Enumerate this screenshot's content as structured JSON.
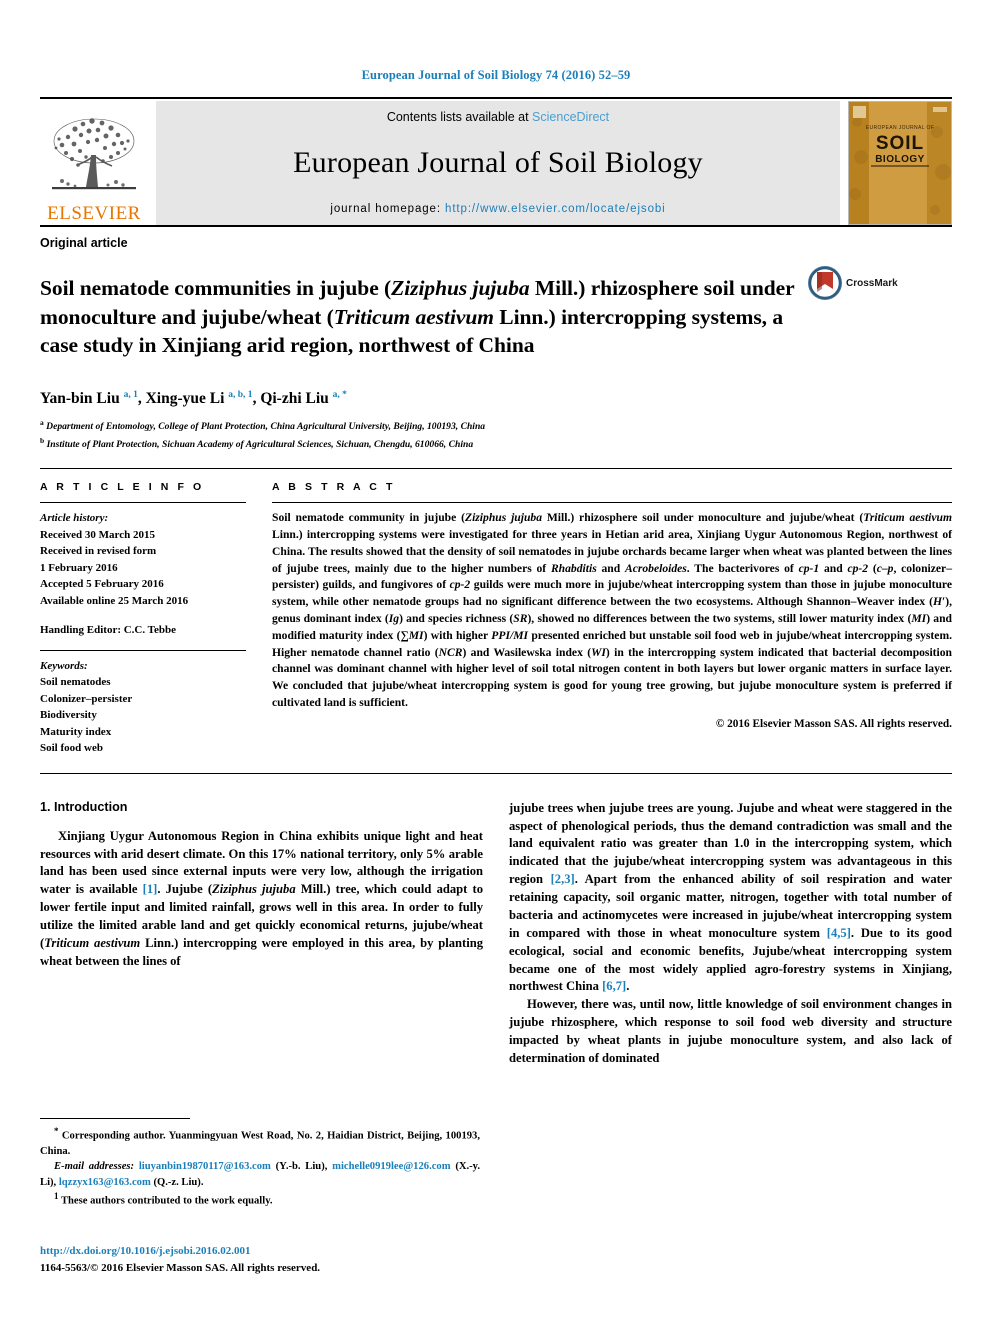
{
  "running_head": "European Journal of Soil Biology 74 (2016) 52–59",
  "header": {
    "contents_prefix": "Contents lists available at ",
    "sciencedirect": "ScienceDirect",
    "journal_title": "European Journal of Soil Biology",
    "homepage_prefix": "journal homepage: ",
    "homepage_url": "http://www.elsevier.com/locate/ejsobi",
    "publisher_logo_text": "ELSEVIER",
    "cover_lines": [
      "EUROPEAN JOURNAL OF",
      "SOIL",
      "BIOLOGY"
    ],
    "accent_link_color": "#1a7fba",
    "sciencedirect_color": "#4a9ed0",
    "elsevier_orange": "#E77500",
    "band_bg": "#e6e6e6"
  },
  "article": {
    "type": "Original article",
    "title_parts": [
      {
        "t": "Soil nematode communities in jujube (",
        "i": false
      },
      {
        "t": "Ziziphus jujuba",
        "i": true
      },
      {
        "t": " Mill.) rhizosphere soil under monoculture and jujube/wheat (",
        "i": false
      },
      {
        "t": "Triticum aestivum",
        "i": true
      },
      {
        "t": " Linn.) intercropping systems, a case study in Xinjiang arid region, northwest of China",
        "i": false
      }
    ],
    "title_plain": "Soil nematode communities in jujube (Ziziphus jujuba Mill.) rhizosphere soil under monoculture and jujube/wheat (Triticum aestivum Linn.) intercropping systems, a case study in Xinjiang arid region, northwest of China",
    "crossmark_label": "CrossMark",
    "authors": [
      {
        "name": "Yan-bin Liu",
        "sup": "a, 1"
      },
      {
        "name": "Xing-yue Li",
        "sup": "a, b, 1"
      },
      {
        "name": "Qi-zhi Liu",
        "sup": "a, *"
      }
    ],
    "affiliations": [
      {
        "mark": "a",
        "text": "Department of Entomology, College of Plant Protection, China Agricultural University, Beijing, 100193, China"
      },
      {
        "mark": "b",
        "text": "Institute of Plant Protection, Sichuan Academy of Agricultural Sciences, Sichuan, Chengdu, 610066, China"
      }
    ]
  },
  "article_info": {
    "heading": "A R T I C L E   I N F O",
    "history_label": "Article history:",
    "history": [
      "Received 30 March 2015",
      "Received in revised form",
      "1 February 2016",
      "Accepted 5 February 2016",
      "Available online 25 March 2016"
    ],
    "handling_editor": "Handling Editor: C.C. Tebbe",
    "keywords_label": "Keywords:",
    "keywords": [
      "Soil nematodes",
      "Colonizer–persister",
      "Biodiversity",
      "Maturity index",
      "Soil food web"
    ]
  },
  "abstract": {
    "heading": "A B S T R A C T",
    "paragraphs": [
      "Soil nematode community in jujube (Ziziphus jujuba Mill.) rhizosphere soil under monoculture and jujube/wheat (Triticum aestivum Linn.) intercropping systems were investigated for three years in Hetian arid area, Xinjiang Uygur Autonomous Region, northwest of China. The results showed that the density of soil nematodes in jujube orchards became larger when wheat was planted between the lines of jujube trees, mainly due to the higher numbers of Rhabditis and Acrobeloides. The bacterivores of cp-1 and cp-2 (c–p, colonizer–persister) guilds, and fungivores of cp-2 guilds were much more in jujube/wheat intercropping system than those in jujube monoculture system, while other nematode groups had no significant difference between the two ecosystems. Although Shannon–Weaver index (H′), genus dominant index (Ig) and species richness (SR), showed no differences between the two systems, still lower maturity index (MI) and modified maturity index (∑MI) with higher PPI/MI presented enriched but unstable soil food web in jujube/wheat intercropping system. Higher nematode channel ratio (NCR) and Wasilewska index (WI) in the intercropping system indicated that bacterial decomposition channel was dominant channel with higher level of soil total nitrogen content in both layers but lower organic matters in surface layer. We concluded that jujube/wheat intercropping system is good for young tree growing, but jujube monoculture system is preferred if cultivated land is sufficient."
    ],
    "copyright": "© 2016 Elsevier Masson SAS. All rights reserved."
  },
  "body": {
    "section_number_title": "1.  Introduction",
    "left_paragraph": "Xinjiang Uygur Autonomous Region in China exhibits unique light and heat resources with arid desert climate. On this 17% national territory, only 5% arable land has been used since external inputs were very low, although the irrigation water is available [1]. Jujube (Ziziphus jujuba Mill.) tree, which could adapt to lower fertile input and limited rainfall, grows well in this area. In order to fully utilize the limited arable land and get quickly economical returns, jujube/wheat (Triticum aestivum Linn.) intercropping were employed in this area, by planting wheat between the lines of",
    "right_paragraph_1": "jujube trees when jujube trees are young. Jujube and wheat were staggered in the aspect of phenological periods, thus the demand contradiction was small and the land equivalent ratio was greater than 1.0 in the intercropping system, which indicated that the jujube/wheat intercropping system was advantageous in this region [2,3]. Apart from the enhanced ability of soil respiration and water retaining capacity, soil organic matter, nitrogen, together with total number of bacteria and actinomycetes were increased in jujube/wheat intercropping system in compared with those in wheat monoculture system [4,5]. Due to its good ecological, social and economic benefits, Jujube/wheat intercropping system became one of the most widely applied agro-forestry systems in Xinjiang, northwest China [6,7].",
    "right_paragraph_2": "However, there was, until now, little knowledge of soil environment changes in jujube rhizosphere, which response to soil food web diversity and structure impacted by wheat plants in jujube monoculture system, and also lack of determination of dominated"
  },
  "footnotes": {
    "corresponding": "Corresponding author. Yuanmingyuan West Road, No. 2, Haidian District, Beijing, 100193, China.",
    "email_label": "E-mail addresses:",
    "emails": [
      {
        "address": "liuyanbin19870117@163.com",
        "owner": "(Y.-b. Liu)"
      },
      {
        "address": "michelle0919lee@126.com",
        "owner": "(X.-y. Li)"
      },
      {
        "address": "lqzzyx163@163.com",
        "owner": "(Q.-z. Liu)"
      }
    ],
    "equal_contribution": "These authors contributed to the work equally.",
    "doi_url": "http://dx.doi.org/10.1016/j.ejsobi.2016.02.001",
    "issn_line": "1164-5563/© 2016 Elsevier Masson SAS. All rights reserved."
  }
}
